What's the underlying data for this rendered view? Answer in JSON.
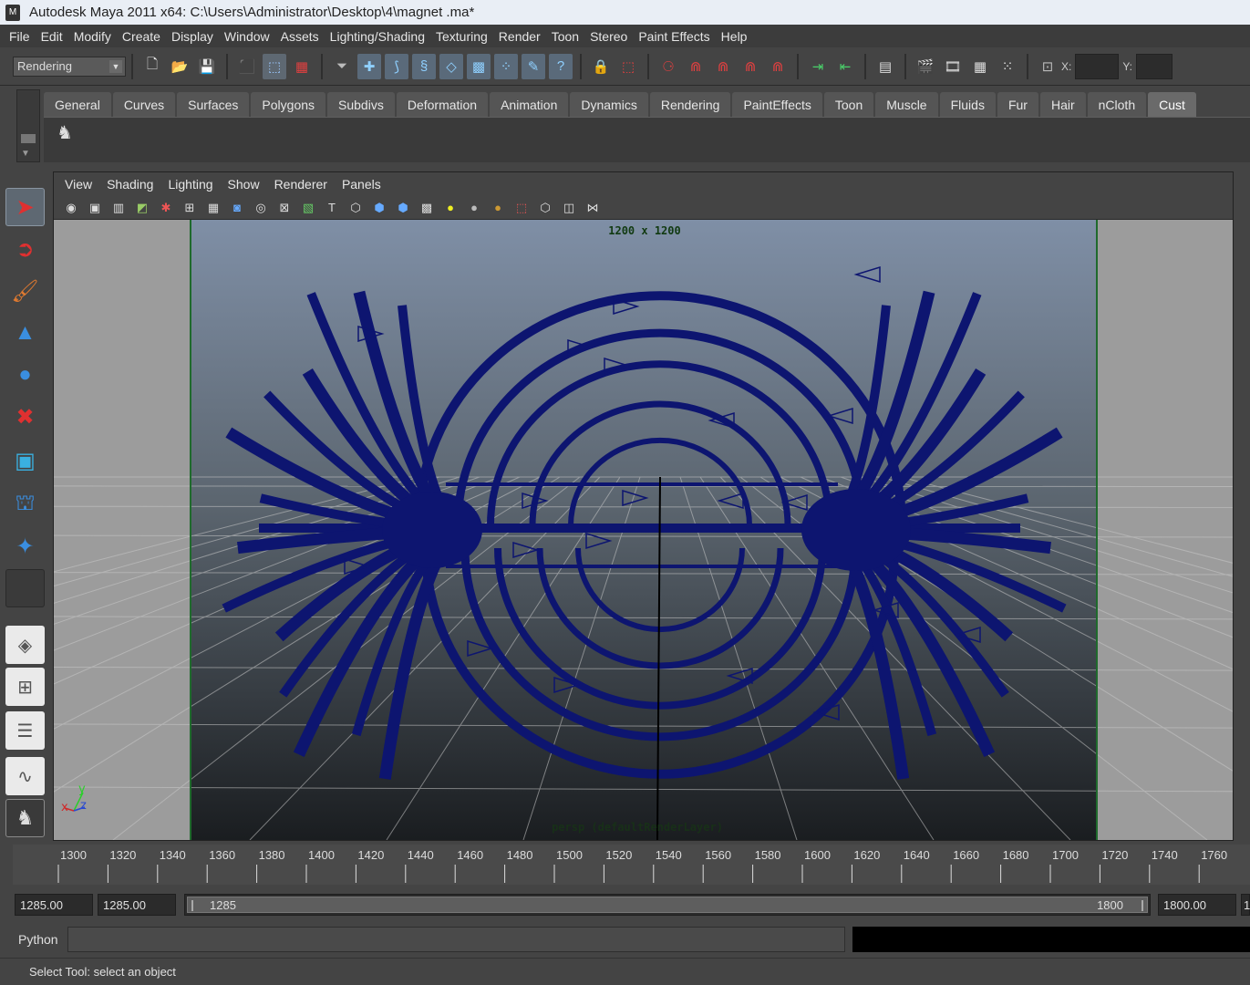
{
  "window": {
    "title": "Autodesk Maya 2011 x64: C:\\Users\\Administrator\\Desktop\\4\\magnet .ma*"
  },
  "menubar": [
    "File",
    "Edit",
    "Modify",
    "Create",
    "Display",
    "Window",
    "Assets",
    "Lighting/Shading",
    "Texturing",
    "Render",
    "Toon",
    "Stereo",
    "Paint Effects",
    "Help"
  ],
  "statusline": {
    "mode": "Rendering",
    "x_label": "X:",
    "y_label": "Y:"
  },
  "shelf": {
    "tabs": [
      "General",
      "Curves",
      "Surfaces",
      "Polygons",
      "Subdivs",
      "Deformation",
      "Animation",
      "Dynamics",
      "Rendering",
      "PaintEffects",
      "Toon",
      "Muscle",
      "Fluids",
      "Fur",
      "Hair",
      "nCloth",
      "Cust"
    ],
    "active_tab": "Cust"
  },
  "panel": {
    "menus": [
      "View",
      "Shading",
      "Lighting",
      "Show",
      "Renderer",
      "Panels"
    ],
    "resolution": "1200 x 1200",
    "camera_label": "persp (defaultRenderLayer)",
    "axis": {
      "y": "y",
      "x": "x",
      "z": "z"
    }
  },
  "timeline": {
    "ticks": [
      "1300",
      "1320",
      "1340",
      "1360",
      "1380",
      "1400",
      "1420",
      "1440",
      "1460",
      "1480",
      "1500",
      "1520",
      "1540",
      "1560",
      "1580",
      "1600",
      "1620",
      "1640",
      "1660",
      "1680",
      "1700",
      "1720",
      "1740",
      "1760"
    ]
  },
  "range": {
    "start_time": "1285.00",
    "playback_start": "1285.00",
    "slider_start": "1285",
    "slider_end": "1800",
    "playback_end": "1800.00",
    "end_time_partial": "1"
  },
  "commandline": {
    "language": "Python"
  },
  "helpline": {
    "text": "Select Tool: select an object"
  },
  "colors": {
    "field_lines": "#0d1570",
    "gate": "#1f6a2c",
    "viewport_top": "#7f8fa6",
    "viewport_bottom": "#1a1d20"
  }
}
